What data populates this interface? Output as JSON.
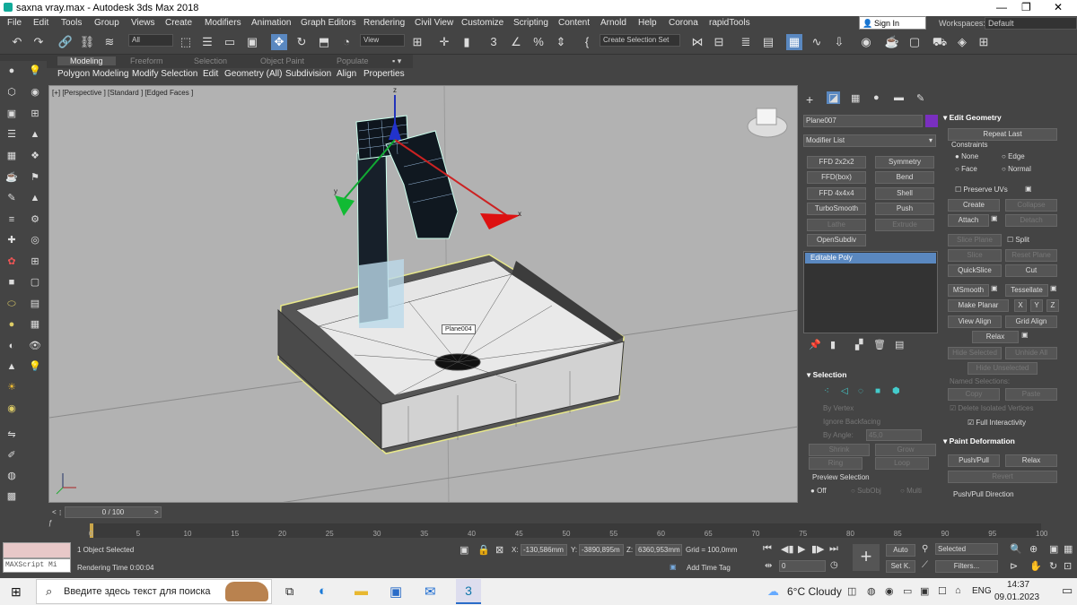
{
  "window": {
    "title": "saxna vray.max - Autodesk 3ds Max 2018"
  },
  "menu": [
    "File",
    "Edit",
    "Tools",
    "Group",
    "Views",
    "Create",
    "Modifiers",
    "Animation",
    "Graph Editors",
    "Rendering",
    "Civil View",
    "Customize",
    "Scripting",
    "Content",
    "Arnold",
    "Help",
    "Corona",
    "rapidTools"
  ],
  "account": {
    "signin": "Sign In",
    "workspaces_label": "Workspaces:",
    "workspace": "Default"
  },
  "toolbar": {
    "filter": "All",
    "refcoord": "View",
    "selset": "Create Selection Set"
  },
  "ribbon": {
    "tabs": [
      "Modeling",
      "Freeform",
      "Selection",
      "Object Paint",
      "Populate"
    ],
    "subtabs": [
      "Polygon Modeling",
      "Modify Selection",
      "Edit",
      "Geometry (All)",
      "Subdivision",
      "Align",
      "Properties"
    ]
  },
  "viewport": {
    "label": "[+] [Perspective ] [Standard ] [Edged Faces ]",
    "object_tag": "Plane004"
  },
  "modify": {
    "object_name": "Plane007",
    "object_color": "#7a2fc0",
    "modifier_list": "Modifier List",
    "modifiers": [
      "FFD 2x2x2",
      "Symmetry",
      "FFD(box)",
      "Bend",
      "FFD 4x4x4",
      "Shell",
      "TurboSmooth",
      "Push",
      "Lathe",
      "Extrude",
      "OpenSubdiv"
    ],
    "stack_item": "Editable Poly",
    "selection": {
      "title": "Selection",
      "by_vertex": "By Vertex",
      "ignore_backfacing": "Ignore Backfacing",
      "by_angle": "By Angle:",
      "angle": "45,0",
      "shrink": "Shrink",
      "grow": "Grow",
      "ring": "Ring",
      "loop": "Loop",
      "preview": "Preview Selection",
      "off": "Off",
      "subobj": "SubObj",
      "multi": "Multi"
    }
  },
  "edit_geometry": {
    "title": "Edit Geometry",
    "repeat_last": "Repeat Last",
    "constraints": "Constraints",
    "none": "None",
    "edge": "Edge",
    "face": "Face",
    "normal": "Normal",
    "preserve_uvs": "Preserve UVs",
    "create": "Create",
    "collapse": "Collapse",
    "attach": "Attach",
    "detach": "Detach",
    "slice_plane": "Slice Plane",
    "split": "Split",
    "slice": "Slice",
    "reset_plane": "Reset Plane",
    "quickslice": "QuickSlice",
    "cut": "Cut",
    "msmooth": "MSmooth",
    "tessellate": "Tessellate",
    "make_planar": "Make Planar",
    "x": "X",
    "y": "Y",
    "z": "Z",
    "view_align": "View Align",
    "grid_align": "Grid Align",
    "relax": "Relax",
    "hide_selected": "Hide Selected",
    "unhide_all": "Unhide All",
    "hide_unselected": "Hide Unselected",
    "named_selections": "Named Selections:",
    "copy": "Copy",
    "paste": "Paste",
    "delete_isolated": "Delete Isolated Vertices",
    "full_interactivity": "Full Interactivity"
  },
  "paint_deformation": {
    "title": "Paint Deformation",
    "push_pull": "Push/Pull",
    "relax": "Relax",
    "revert": "Revert",
    "direction": "Push/Pull Direction"
  },
  "timeline": {
    "frame": "0 / 100",
    "ticks": [
      "0",
      "5",
      "10",
      "15",
      "20",
      "25",
      "30",
      "35",
      "40",
      "45",
      "50",
      "55",
      "60",
      "65",
      "70",
      "75",
      "80",
      "85",
      "90",
      "95",
      "100"
    ]
  },
  "status": {
    "maxscript": "MAXScript Mi",
    "selected": "1 Object Selected",
    "render_time": "Rendering Time  0:00:04",
    "x_label": "X:",
    "x": "-130,586mm",
    "y_label": "Y:",
    "y": "-3890,895m",
    "z_label": "Z:",
    "z": "6360,953mm",
    "grid": "Grid = 100,0mm",
    "add_time_tag": "Add Time Tag",
    "frame_field": "0",
    "auto": "Auto",
    "setk": "Set K.",
    "selected_dd": "Selected",
    "filters": "Filters..."
  },
  "taskbar": {
    "search": "Введите здесь текст для поиска",
    "weather": "6°C  Cloudy",
    "lang": "ENG",
    "time": "14:37",
    "date": "09.01.2023"
  }
}
